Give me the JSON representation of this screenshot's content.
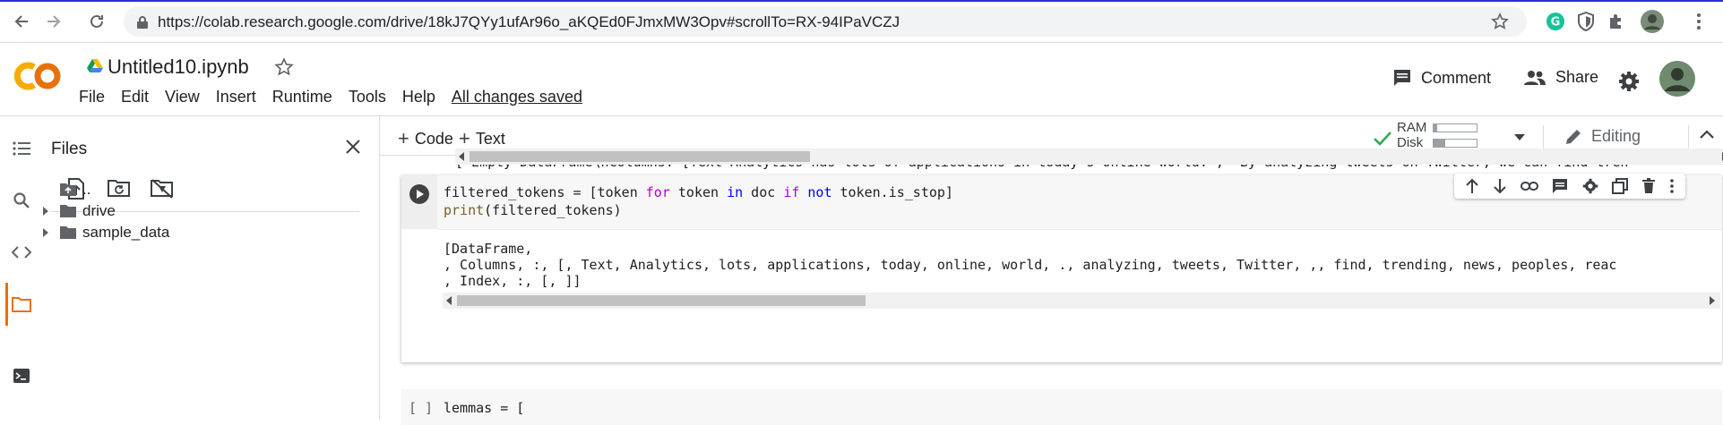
{
  "browser": {
    "url": "https://colab.research.google.com/drive/18kJ7QYy1ufAr96o_aKQEd0FJmxMW3Opv#scrollTo=RX-94IPaVCZJ"
  },
  "header": {
    "notebook_title": "Untitled10.ipynb",
    "menu": [
      "File",
      "Edit",
      "View",
      "Insert",
      "Runtime",
      "Tools",
      "Help"
    ],
    "save_status": "All changes saved",
    "comment_label": "Comment",
    "share_label": "Share"
  },
  "files_panel": {
    "title": "Files",
    "tree": [
      {
        "label": "..",
        "kind": "parent"
      },
      {
        "label": "drive",
        "kind": "folder"
      },
      {
        "label": "sample_data",
        "kind": "folder"
      }
    ]
  },
  "toolbar": {
    "add_code": "Code",
    "add_text": "Text",
    "ram_label": "RAM",
    "disk_label": "Disk",
    "ram_usage": 0.08,
    "disk_usage": 0.28,
    "editing_label": "Editing"
  },
  "previous_output": {
    "line": "[\"Empty DataFrame\\nColumns: [Text Analytics has lots of applications in today's online world.\", 'By analyzing tweets on Twitter, we can find tren"
  },
  "cell": {
    "code_line_1": {
      "a": "filtered_tokens = [token ",
      "b": "for",
      "c": " token ",
      "d": "in",
      "e": " doc ",
      "f": "if",
      "g": " ",
      "h": "not",
      "i": " token.is_stop]"
    },
    "code_line_2": {
      "fn": "print",
      "rest": "(filtered_tokens)"
    },
    "output": [
      "[DataFrame,",
      ", Columns, :, [, Text, Analytics, lots, applications, today, online, world, ., analyzing, tweets, Twitter, ,, find, trending, news, peoples, reac",
      ", Index, :, [, ]]"
    ]
  },
  "next_cell": {
    "gutter": "[ ]",
    "code": "lemmas = ["
  },
  "colors": {
    "accent": "#e8710a",
    "check_green": "#34a853"
  }
}
